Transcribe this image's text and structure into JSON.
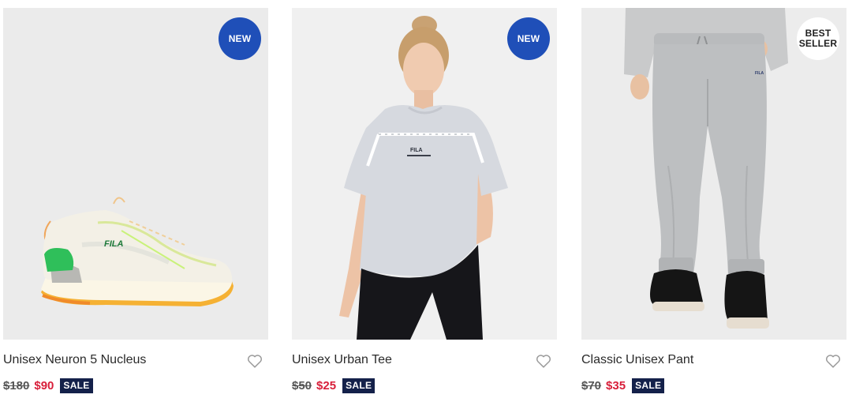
{
  "colors": {
    "badge_new_bg": "#1f4fb8",
    "sale_price": "#d81f3a",
    "sale_tag_bg": "#14214a"
  },
  "products": [
    {
      "name": "Unisex Neuron 5 Nucleus",
      "badge": "NEW",
      "original_price": "$180",
      "sale_price": "$90",
      "sale_label": "SALE",
      "image": "white-sneaker-with-green-and-orange-accents"
    },
    {
      "name": "Unisex Urban Tee",
      "badge": "NEW",
      "original_price": "$50",
      "sale_price": "$25",
      "sale_label": "SALE",
      "image": "model-wearing-grey-tee-and-black-jeans"
    },
    {
      "name": "Classic Unisex Pant",
      "badge": "BEST\nSELLER",
      "original_price": "$70",
      "sale_price": "$35",
      "sale_label": "SALE",
      "image": "grey-jogger-pants-with-black-sneakers"
    }
  ],
  "icons": {
    "wishlist": "heart-outline-icon"
  }
}
